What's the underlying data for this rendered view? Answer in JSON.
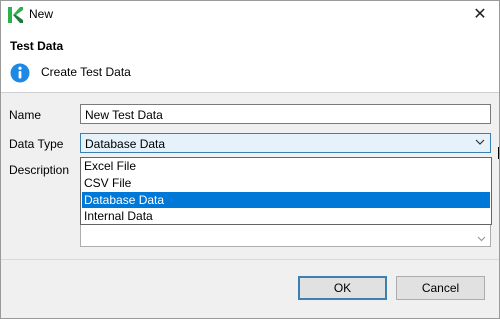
{
  "window": {
    "title": "New",
    "close_glyph": "✕"
  },
  "header": {
    "title": "Test Data",
    "description": "Create Test Data"
  },
  "form": {
    "name_label": "Name",
    "name_value": "New Test Data",
    "data_type_label": "Data Type",
    "data_type_value": "Database Data",
    "description_label": "Description"
  },
  "dropdown": {
    "options": [
      "Excel File",
      "CSV File",
      "Database Data",
      "Internal Data"
    ],
    "selected_index": 2
  },
  "buttons": {
    "ok": "OK",
    "cancel": "Cancel"
  },
  "colors": {
    "selection": "#0078d7",
    "combo_focus": "#e5f1fb",
    "accent_green": "#2bb24c",
    "info_blue": "#1e88e5"
  }
}
